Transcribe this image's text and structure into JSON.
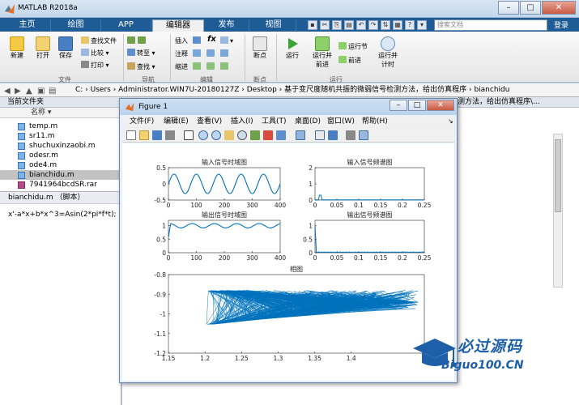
{
  "window": {
    "title": "MATLAB R2018a"
  },
  "tabs": [
    "主页",
    "绘图",
    "APP",
    "编辑器",
    "发布",
    "视图"
  ],
  "active_tab": "编辑器",
  "search": {
    "placeholder": "搜索文档"
  },
  "login_label": "登录",
  "ribbon": {
    "file": {
      "new": "新建",
      "open": "打开",
      "save": "保存",
      "find_files": "查找文件",
      "compare": "比较",
      "print": "打印",
      "group": "文件"
    },
    "nav": {
      "goto": "转至",
      "find": "查找",
      "group": "导航"
    },
    "edit": {
      "insert": "插入",
      "comment": "注释",
      "indent": "缩进",
      "group": "编辑",
      "fx": "fx"
    },
    "breakpoints": {
      "label": "断点",
      "group": "断点"
    },
    "run": {
      "run": "运行",
      "run_advance": "运行并\n前进",
      "run_section": "运行节",
      "advance": "前进",
      "run_time": "运行并\n计时",
      "group": "运行"
    }
  },
  "address": {
    "path": "C: › Users › Administrator.WIN7U-20180127Z › Desktop › 基于变尺度随机共振的微弱信号检测方法，给出仿真程序 › bianchidu"
  },
  "current_folder": {
    "header": "当前文件夹",
    "col_name": "名称 ▾",
    "files": [
      "temp.m",
      "sr11.m",
      "shuchuxinzaobi.m",
      "odesr.m",
      "ode4.m",
      "bianchidu.m",
      "7941964bcdSR.rar"
    ],
    "selected": "bianchidu.m"
  },
  "details": {
    "label": "bianchidu.m （脚本）",
    "code": "x'-a*x+b*x^3=Asin(2*pi*f*t);"
  },
  "editor": {
    "header_fragment": "测方法，给出仿真程序\\..."
  },
  "figure": {
    "title": "Figure 1",
    "menu": [
      "文件(F)",
      "编辑(E)",
      "查看(V)",
      "插入(I)",
      "工具(T)",
      "桌面(D)",
      "窗口(W)",
      "帮助(H)"
    ],
    "chart_data": [
      {
        "type": "line",
        "title": "输入信号时域图",
        "xlim": [
          0,
          400
        ],
        "ylim": [
          -0.5,
          0.5
        ],
        "x_ticks": [
          "0",
          "100",
          "200",
          "300",
          "400"
        ],
        "y_ticks": [
          "0.5",
          "0",
          "-0.5"
        ],
        "series": [
          {
            "description": "sinusoid",
            "amplitude": 0.3,
            "cycles": 5
          }
        ]
      },
      {
        "type": "line",
        "title": "输入信号频谱图",
        "xlim": [
          0,
          0.25
        ],
        "ylim": [
          0,
          2
        ],
        "x_ticks": [
          "0",
          "0.05",
          "0.1",
          "0.15",
          "0.2",
          "0.25"
        ],
        "y_ticks": [
          "2",
          "1",
          "0"
        ],
        "series": [
          {
            "peak_x": 0.012,
            "peak_y": 0.3
          }
        ]
      },
      {
        "type": "line",
        "title": "输出信号时域图",
        "xlim": [
          0,
          400
        ],
        "ylim": [
          0,
          1.2
        ],
        "x_ticks": [
          "0",
          "100",
          "200",
          "300",
          "400"
        ],
        "y_ticks": [
          "1",
          "0.5",
          "0"
        ],
        "series": [
          {
            "level": 1.0,
            "ripple": 0.08
          }
        ]
      },
      {
        "type": "line",
        "title": "输出信号频谱图",
        "xlim": [
          0,
          0.25
        ],
        "ylim": [
          0,
          1.2
        ],
        "x_ticks": [
          "0",
          "0.05",
          "0.1",
          "0.15",
          "0.2",
          "0.25"
        ],
        "y_ticks": [
          "1",
          "0.5",
          "0"
        ],
        "series": [
          {
            "peak_x": 0.0,
            "peak_y": 1.0
          }
        ]
      },
      {
        "type": "line",
        "title": "相图",
        "xlim": [
          1.15,
          1.5
        ],
        "ylim": [
          -1.2,
          -0.8
        ],
        "x_ticks": [
          "1.15",
          "1.2",
          "1.25",
          "1.3",
          "1.35",
          "1.4"
        ],
        "y_ticks": [
          "-0.8",
          "-0.9",
          "-1",
          "-1.1",
          "-1.2"
        ],
        "series": [
          {
            "x_range": [
              1.19,
              1.49
            ],
            "y_range": [
              -1.09,
              -0.86
            ]
          }
        ]
      }
    ]
  },
  "watermark": {
    "line1": "必过源码",
    "line2": "Biguo100.CN"
  },
  "colors": {
    "plot_line": "#0072bd",
    "tab_bar": "#1f5c96"
  }
}
